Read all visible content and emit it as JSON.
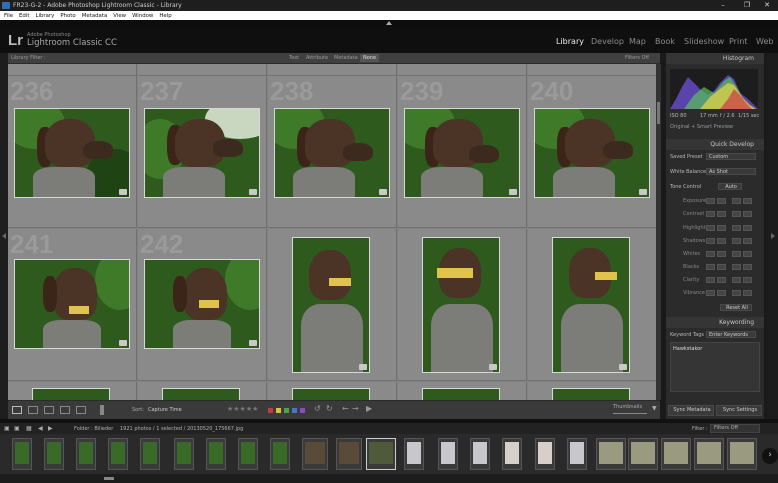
{
  "window": {
    "title": "FR23-G-2 - Adobe Photoshop Lightroom Classic - Library"
  },
  "menu": [
    "File",
    "Edit",
    "Library",
    "Photo",
    "Metadata",
    "View",
    "Window",
    "Help"
  ],
  "identity": {
    "logo": "Lr",
    "brand_small": "Adobe Photoshop",
    "brand": "Lightroom Classic CC"
  },
  "modules": [
    "Library",
    "Develop",
    "Map",
    "Book",
    "Slideshow",
    "Print",
    "Web"
  ],
  "active_module": "Library",
  "filter_bar": {
    "label": "Library Filter :",
    "tabs": [
      "Text",
      "Attribute",
      "Metadata",
      "None"
    ],
    "active": "None",
    "filters_off": "Filters Off"
  },
  "grid": {
    "row1": [
      "236",
      "237",
      "238",
      "239",
      "240"
    ],
    "row2": [
      "241",
      "242",
      "",
      "",
      ""
    ]
  },
  "toolbar": {
    "sort_label": "Sort:",
    "sort_value": "Capture Time",
    "thumbnails": "Thumbnails",
    "stars": "★★★★★"
  },
  "panel": {
    "histogram_title": "Histogram",
    "exif": [
      "ISO 80",
      "17 mm",
      "f / 2.6",
      "1/15 sec"
    ],
    "preview_label": "Original + Smart Preview",
    "quick_develop_title": "Quick Develop",
    "saved_preset_label": "Saved Preset",
    "saved_preset_value": "Custom",
    "white_balance_label": "White Balance",
    "white_balance_value": "As Shot",
    "tone_control_label": "Tone Control",
    "auto_label": "Auto",
    "tone_rows": [
      "Exposure",
      "Contrast",
      "Highlights",
      "Shadows",
      "Whites",
      "Blacks",
      "Clarity",
      "Vibrance"
    ],
    "reset_all": "Reset All",
    "keywording_title": "Keywording",
    "keyword_tags_label": "Keyword Tags",
    "keyword_tags_value": "Enter Keywords",
    "keyword": "Hawkstakor",
    "sync_metadata": "Sync Metadata",
    "sync_settings": "Sync Settings"
  },
  "filmstrip_bar": {
    "folder": "Folder : Bilieder",
    "count": "1921 photos / 1 selected / 20130520_175667.jpg",
    "filter_label": "Filter :",
    "filter_value": "Filters Off"
  },
  "colors": {
    "accent": "#ffffff",
    "label_red": "#c13d3d",
    "label_yellow": "#d6c43a",
    "label_green": "#4aa54a",
    "label_blue": "#4b73c8",
    "label_purple": "#8a4bc8"
  }
}
